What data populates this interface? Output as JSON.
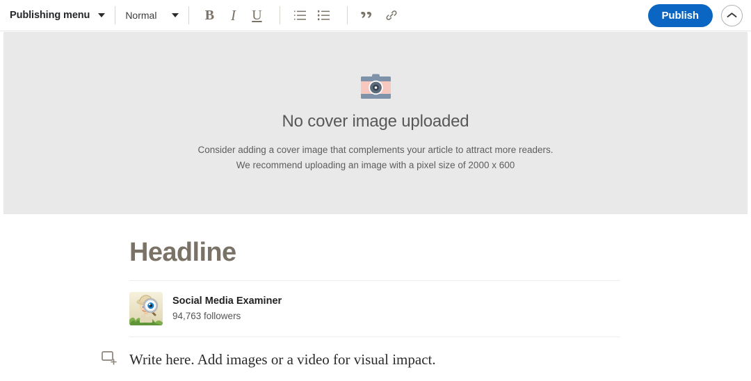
{
  "toolbar": {
    "publishing_menu_label": "Publishing menu",
    "publishing_menu_caret": "chevron-down-icon",
    "text_style_label": "Normal",
    "text_style_caret": "chevron-down-icon",
    "bold_label": "B",
    "italic_label": "I",
    "underline_label": "U",
    "ordered_list_icon": "ordered-list-icon",
    "bulleted_list_icon": "bulleted-list-icon",
    "quote_icon": "quote-icon",
    "link_icon": "link-icon",
    "publish_label": "Publish",
    "collapse_icon": "chevron-up-icon",
    "publish_color": "#0a66c2",
    "icon_color": "#7a7266"
  },
  "cover": {
    "camera_icon": "camera-icon",
    "title": "No cover image uploaded",
    "subtitle_line1": "Consider adding a cover image that complements your article to attract more readers.",
    "subtitle_line2": "We recommend uploading an image with a pixel size of 2000 x 600",
    "background_color": "#e9e9e9"
  },
  "article": {
    "headline_placeholder": "Headline",
    "headline_color": "#7a7266",
    "author": {
      "avatar_icon": "social-media-examiner-logo",
      "name": "Social Media Examiner",
      "followers": "94,763 followers"
    },
    "body_placeholder": "Write here. Add images or a video for visual impact.",
    "add_block_icon": "add-image-block-icon"
  }
}
